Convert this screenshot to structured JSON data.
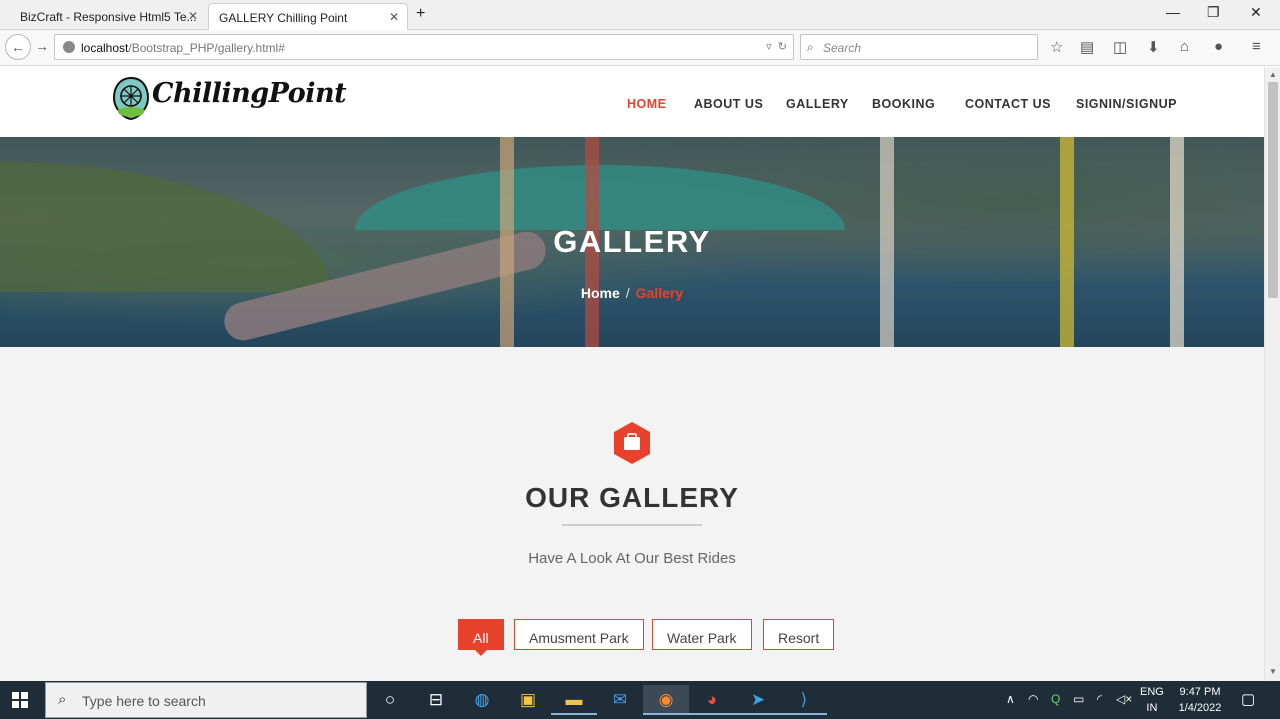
{
  "browser": {
    "tabs": [
      {
        "title": "BizCraft - Responsive Html5 Te..."
      },
      {
        "title": "GALLERY Chilling Point"
      }
    ],
    "url_host": "localhost",
    "url_path": "/Bootstrap_PHP/gallery.html#",
    "search_placeholder": "Search"
  },
  "site": {
    "logo_text": "ChillingPoint",
    "nav": [
      {
        "label": "HOME"
      },
      {
        "label": "ABOUT US"
      },
      {
        "label": "GALLERY"
      },
      {
        "label": "BOOKING"
      },
      {
        "label": "CONTACT US"
      },
      {
        "label": "SIGNIN/SIGNUP"
      }
    ],
    "active_nav": "HOME",
    "accent_color": "#e8412c"
  },
  "hero": {
    "title": "GALLERY",
    "breadcrumb_home": "Home",
    "breadcrumb_sep": "/",
    "breadcrumb_current": "Gallery"
  },
  "gallery": {
    "title": "OUR GALLERY",
    "subtitle": "Have A Look At Our Best Rides",
    "filters": [
      {
        "label": "All"
      },
      {
        "label": "Amusment Park"
      },
      {
        "label": "Water Park"
      },
      {
        "label": "Resort"
      }
    ],
    "active_filter": "All"
  },
  "taskbar": {
    "search_placeholder": "Type here to search",
    "lang_line1": "ENG",
    "lang_line2": "IN",
    "time": "9:47 PM",
    "date": "1/4/2022"
  }
}
